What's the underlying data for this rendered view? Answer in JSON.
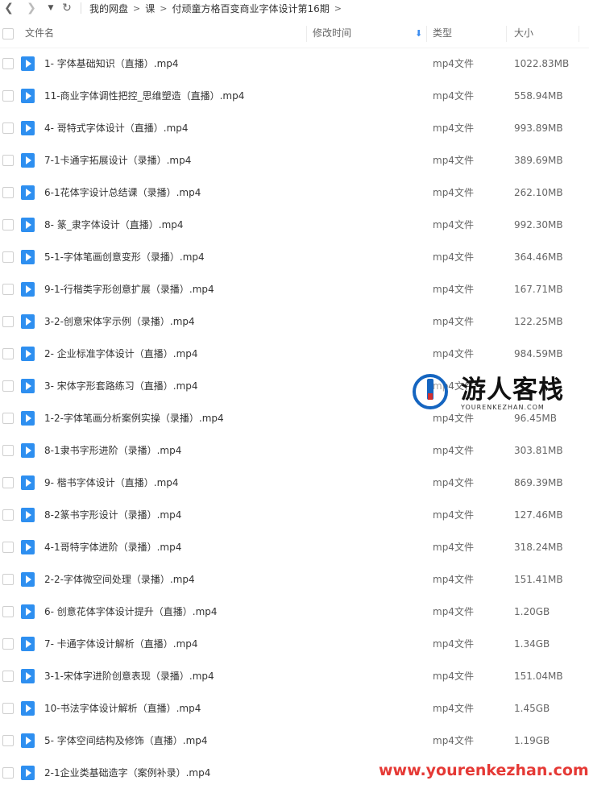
{
  "breadcrumb": [
    "我的网盘",
    "课",
    "付顽童方格百变商业字体设计第16期"
  ],
  "columns": {
    "name": "文件名",
    "modified": "修改时间",
    "type": "类型",
    "size": "大小"
  },
  "files": [
    {
      "name": "1- 字体基础知识（直播）.mp4",
      "type": "mp4文件",
      "size": "1022.83MB"
    },
    {
      "name": "11-商业字体调性把控_思维塑造（直播）.mp4",
      "type": "mp4文件",
      "size": "558.94MB"
    },
    {
      "name": "4- 哥特式字体设计（直播）.mp4",
      "type": "mp4文件",
      "size": "993.89MB"
    },
    {
      "name": "7-1卡通字拓展设计（录播）.mp4",
      "type": "mp4文件",
      "size": "389.69MB"
    },
    {
      "name": "6-1花体字设计总结课（录播）.mp4",
      "type": "mp4文件",
      "size": "262.10MB"
    },
    {
      "name": "8- 篆_隶字体设计（直播）.mp4",
      "type": "mp4文件",
      "size": "992.30MB"
    },
    {
      "name": "5-1-字体笔画创意变形（录播）.mp4",
      "type": "mp4文件",
      "size": "364.46MB"
    },
    {
      "name": "9-1-行楷类字形创意扩展（录播）.mp4",
      "type": "mp4文件",
      "size": "167.71MB"
    },
    {
      "name": "3-2-创意宋体字示例（录播）.mp4",
      "type": "mp4文件",
      "size": "122.25MB"
    },
    {
      "name": "2- 企业标准字体设计（直播）.mp4",
      "type": "mp4文件",
      "size": "984.59MB"
    },
    {
      "name": "3- 宋体字形套路练习（直播）.mp4",
      "type": "mp4文件",
      "size": ""
    },
    {
      "name": "1-2-字体笔画分析案例实操（录播）.mp4",
      "type": "mp4文件",
      "size": "96.45MB"
    },
    {
      "name": "8-1隶书字形进阶（录播）.mp4",
      "type": "mp4文件",
      "size": "303.81MB"
    },
    {
      "name": "9- 楷书字体设计（直播）.mp4",
      "type": "mp4文件",
      "size": "869.39MB"
    },
    {
      "name": "8-2篆书字形设计（录播）.mp4",
      "type": "mp4文件",
      "size": "127.46MB"
    },
    {
      "name": "4-1哥特字体进阶（录播）.mp4",
      "type": "mp4文件",
      "size": "318.24MB"
    },
    {
      "name": "2-2-字体微空间处理（录播）.mp4",
      "type": "mp4文件",
      "size": "151.41MB"
    },
    {
      "name": "6- 创意花体字体设计提升（直播）.mp4",
      "type": "mp4文件",
      "size": "1.20GB"
    },
    {
      "name": "7- 卡通字体设计解析（直播）.mp4",
      "type": "mp4文件",
      "size": "1.34GB"
    },
    {
      "name": "3-1-宋体字进阶创意表现（录播）.mp4",
      "type": "mp4文件",
      "size": "151.04MB"
    },
    {
      "name": "10-书法字体设计解析（直播）.mp4",
      "type": "mp4文件",
      "size": "1.45GB"
    },
    {
      "name": "5- 字体空间结构及修饰（直播）.mp4",
      "type": "mp4文件",
      "size": "1.19GB"
    },
    {
      "name": "2-1企业类基础造字（案例补录）.mp4",
      "type": "",
      "size": ""
    }
  ],
  "watermark": {
    "title": "游人客栈",
    "subtitle": "YOURENKEZHAN.COM",
    "url": "www.yourenkezhan.com"
  },
  "icons": {
    "file": "video-file-icon",
    "accent": "#2e8ff0"
  }
}
